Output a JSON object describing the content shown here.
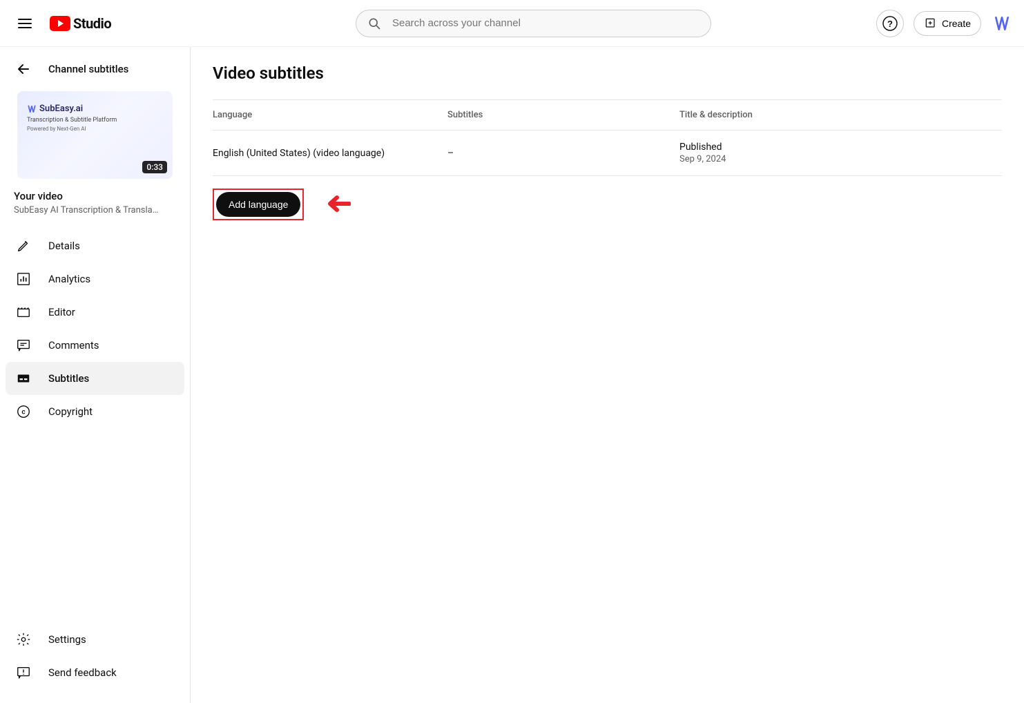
{
  "header": {
    "logo_text": "Studio",
    "search_placeholder": "Search across your channel",
    "create_label": "Create"
  },
  "sidebar": {
    "back_title": "Channel subtitles",
    "your_video_label": "Your video",
    "video_title": "SubEasy AI Transcription & Translati…",
    "thumb": {
      "brand": "SubEasy.ai",
      "subtitle": "Transcription & Subtitle Platform",
      "powered": "Powered by Next-Gen AI",
      "duration": "0:33"
    },
    "nav": [
      {
        "label": "Details"
      },
      {
        "label": "Analytics"
      },
      {
        "label": "Editor"
      },
      {
        "label": "Comments"
      },
      {
        "label": "Subtitles"
      },
      {
        "label": "Copyright"
      }
    ],
    "bottom": [
      {
        "label": "Settings"
      },
      {
        "label": "Send feedback"
      }
    ]
  },
  "main": {
    "page_title": "Video subtitles",
    "columns": {
      "language": "Language",
      "subtitles": "Subtitles",
      "title_desc": "Title & description"
    },
    "rows": [
      {
        "language": "English (United States) (video language)",
        "subtitles": "–",
        "status": "Published",
        "date": "Sep 9, 2024"
      }
    ],
    "add_language_label": "Add language"
  }
}
